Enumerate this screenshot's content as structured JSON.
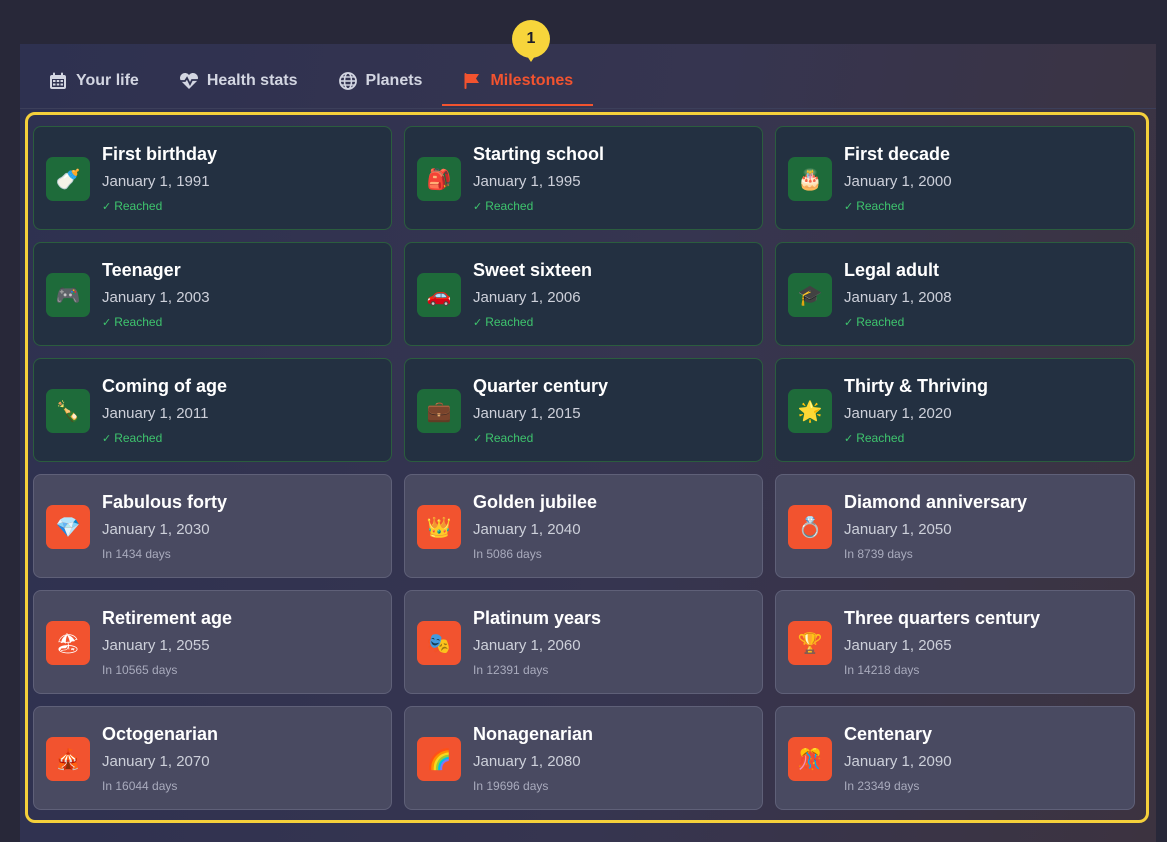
{
  "tabs": [
    {
      "label": "Your life",
      "icon": "calendar-icon",
      "active": false
    },
    {
      "label": "Health stats",
      "icon": "heartbeat-icon",
      "active": false
    },
    {
      "label": "Planets",
      "icon": "globe-icon",
      "active": false
    },
    {
      "label": "Milestones",
      "icon": "flag-icon",
      "active": true
    }
  ],
  "step_badge": "1",
  "colors": {
    "accent": "#f2532f",
    "reached": "#3ec46d",
    "highlight": "#f5d03b"
  },
  "milestones": [
    {
      "title": "First birthday",
      "date": "January 1, 1991",
      "status": "Reached",
      "emoji": "🍼",
      "icon": "baby-bottle-icon",
      "reached": true
    },
    {
      "title": "Starting school",
      "date": "January 1, 1995",
      "status": "Reached",
      "emoji": "🎒",
      "icon": "backpack-icon",
      "reached": true
    },
    {
      "title": "First decade",
      "date": "January 1, 2000",
      "status": "Reached",
      "emoji": "🎂",
      "icon": "birthday-cake-icon",
      "reached": true
    },
    {
      "title": "Teenager",
      "date": "January 1, 2003",
      "status": "Reached",
      "emoji": "🎮",
      "icon": "game-controller-icon",
      "reached": true
    },
    {
      "title": "Sweet sixteen",
      "date": "January 1, 2006",
      "status": "Reached",
      "emoji": "🚗",
      "icon": "car-icon",
      "reached": true
    },
    {
      "title": "Legal adult",
      "date": "January 1, 2008",
      "status": "Reached",
      "emoji": "🎓",
      "icon": "graduation-cap-icon",
      "reached": true
    },
    {
      "title": "Coming of age",
      "date": "January 1, 2011",
      "status": "Reached",
      "emoji": "🍾",
      "icon": "champagne-icon",
      "reached": true
    },
    {
      "title": "Quarter century",
      "date": "January 1, 2015",
      "status": "Reached",
      "emoji": "💼",
      "icon": "briefcase-icon",
      "reached": true
    },
    {
      "title": "Thirty & Thriving",
      "date": "January 1, 2020",
      "status": "Reached",
      "emoji": "🌟",
      "icon": "star-icon",
      "reached": true
    },
    {
      "title": "Fabulous forty",
      "date": "January 1, 2030",
      "status": "In 1434 days",
      "emoji": "💎",
      "icon": "diamond-icon",
      "reached": false
    },
    {
      "title": "Golden jubilee",
      "date": "January 1, 2040",
      "status": "In 5086 days",
      "emoji": "👑",
      "icon": "crown-icon",
      "reached": false
    },
    {
      "title": "Diamond anniversary",
      "date": "January 1, 2050",
      "status": "In 8739 days",
      "emoji": "💍",
      "icon": "ring-icon",
      "reached": false
    },
    {
      "title": "Retirement age",
      "date": "January 1, 2055",
      "status": "In 10565 days",
      "emoji": "🏖",
      "icon": "beach-icon",
      "reached": false
    },
    {
      "title": "Platinum years",
      "date": "January 1, 2060",
      "status": "In 12391 days",
      "emoji": "🎭",
      "icon": "theater-icon",
      "reached": false
    },
    {
      "title": "Three quarters century",
      "date": "January 1, 2065",
      "status": "In 14218 days",
      "emoji": "🏆",
      "icon": "trophy-icon",
      "reached": false
    },
    {
      "title": "Octogenarian",
      "date": "January 1, 2070",
      "status": "In 16044 days",
      "emoji": "🎪",
      "icon": "circus-tent-icon",
      "reached": false
    },
    {
      "title": "Nonagenarian",
      "date": "January 1, 2080",
      "status": "In 19696 days",
      "emoji": "🌈",
      "icon": "rainbow-icon",
      "reached": false
    },
    {
      "title": "Centenary",
      "date": "January 1, 2090",
      "status": "In 23349 days",
      "emoji": "🎊",
      "icon": "confetti-icon",
      "reached": false
    }
  ]
}
